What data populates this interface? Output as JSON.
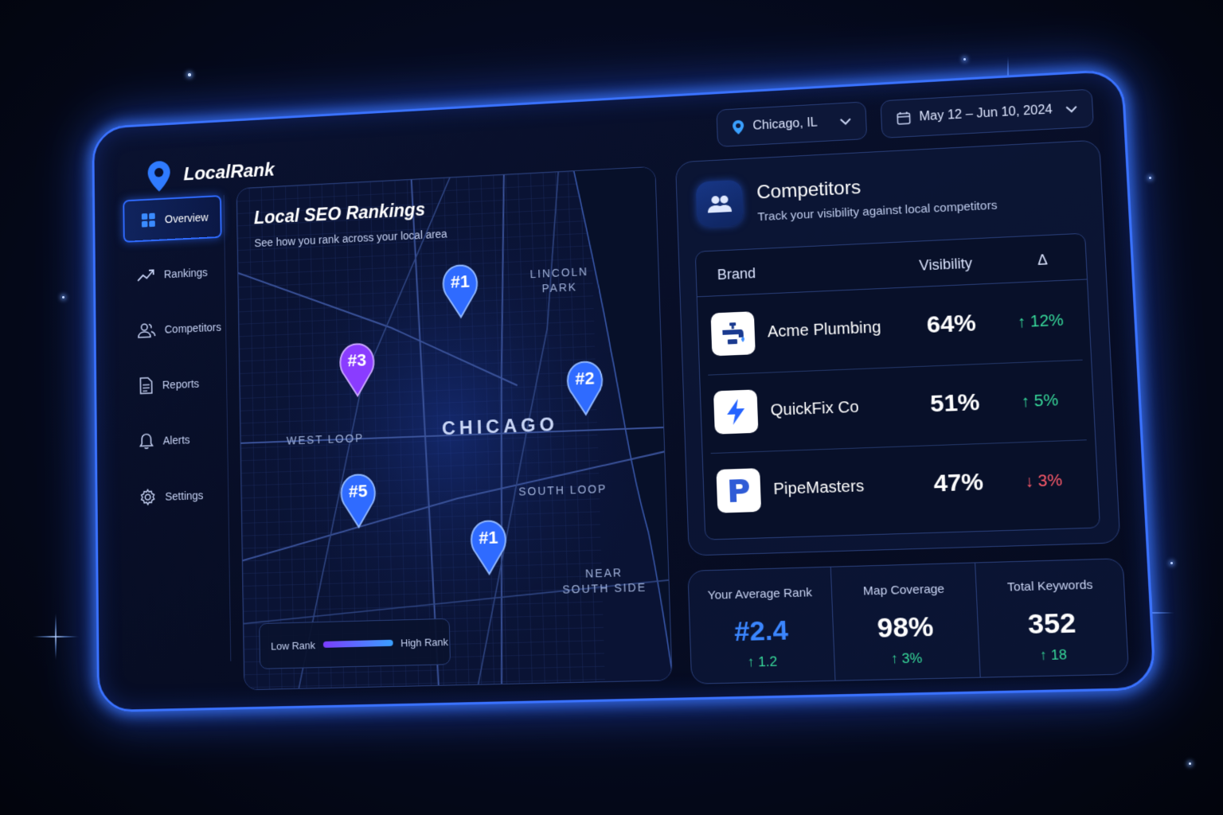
{
  "app": {
    "name": "LocalRank"
  },
  "filters": {
    "location": "Chicago, IL",
    "date_range": "May 12 – Jun 10, 2024"
  },
  "sidebar": {
    "items": [
      {
        "label": "Overview",
        "icon": "grid-icon",
        "active": true
      },
      {
        "label": "Rankings",
        "icon": "trend-icon",
        "active": false
      },
      {
        "label": "Competitors",
        "icon": "users-icon",
        "active": false
      },
      {
        "label": "Reports",
        "icon": "document-icon",
        "active": false
      },
      {
        "label": "Alerts",
        "icon": "bell-icon",
        "active": false
      },
      {
        "label": "Settings",
        "icon": "gear-icon",
        "active": false
      }
    ]
  },
  "map": {
    "title": "Local SEO Rankings",
    "subtitle": "See how you rank across your local area",
    "labels": {
      "lincoln_park": "LINCOLN\nPARK",
      "west_loop": "WEST LOOP",
      "chicago": "CHICAGO",
      "south_loop": "SOUTH LOOP",
      "near_south_side": "NEAR\nSOUTH SIDE"
    },
    "pins": [
      {
        "rank": "#1",
        "color": "#2f6bff"
      },
      {
        "rank": "#3",
        "color": "#8a3cff"
      },
      {
        "rank": "#2",
        "color": "#2f6bff"
      },
      {
        "rank": "#5",
        "color": "#2f6bff"
      },
      {
        "rank": "#1",
        "color": "#2f6bff"
      }
    ],
    "legend": {
      "low": "Low Rank",
      "high": "High Rank"
    }
  },
  "competitors": {
    "title": "Competitors",
    "subtitle": "Track your visibility against local competitors",
    "columns": {
      "brand": "Brand",
      "visibility": "Visibility",
      "delta": "Δ"
    },
    "rows": [
      {
        "brand": "Acme Plumbing",
        "visibility": "64%",
        "delta": "↑ 12%",
        "trend": "up",
        "logo": "faucet-icon"
      },
      {
        "brand": "QuickFix Co",
        "visibility": "51%",
        "delta": "↑ 5%",
        "trend": "up",
        "logo": "bolt-icon"
      },
      {
        "brand": "PipeMasters",
        "visibility": "47%",
        "delta": "↓ 3%",
        "trend": "down",
        "logo": "letter-p-icon"
      }
    ]
  },
  "stats": [
    {
      "label": "Your Average Rank",
      "value": "#2.4",
      "delta": "↑ 1.2"
    },
    {
      "label": "Map Coverage",
      "value": "98%",
      "delta": "↑ 3%"
    },
    {
      "label": "Total Keywords",
      "value": "352",
      "delta": "↑ 18"
    }
  ],
  "colors": {
    "accent": "#2f6bff",
    "up": "#37d99a",
    "down": "#ff5b6b",
    "purple": "#8a3cff"
  }
}
